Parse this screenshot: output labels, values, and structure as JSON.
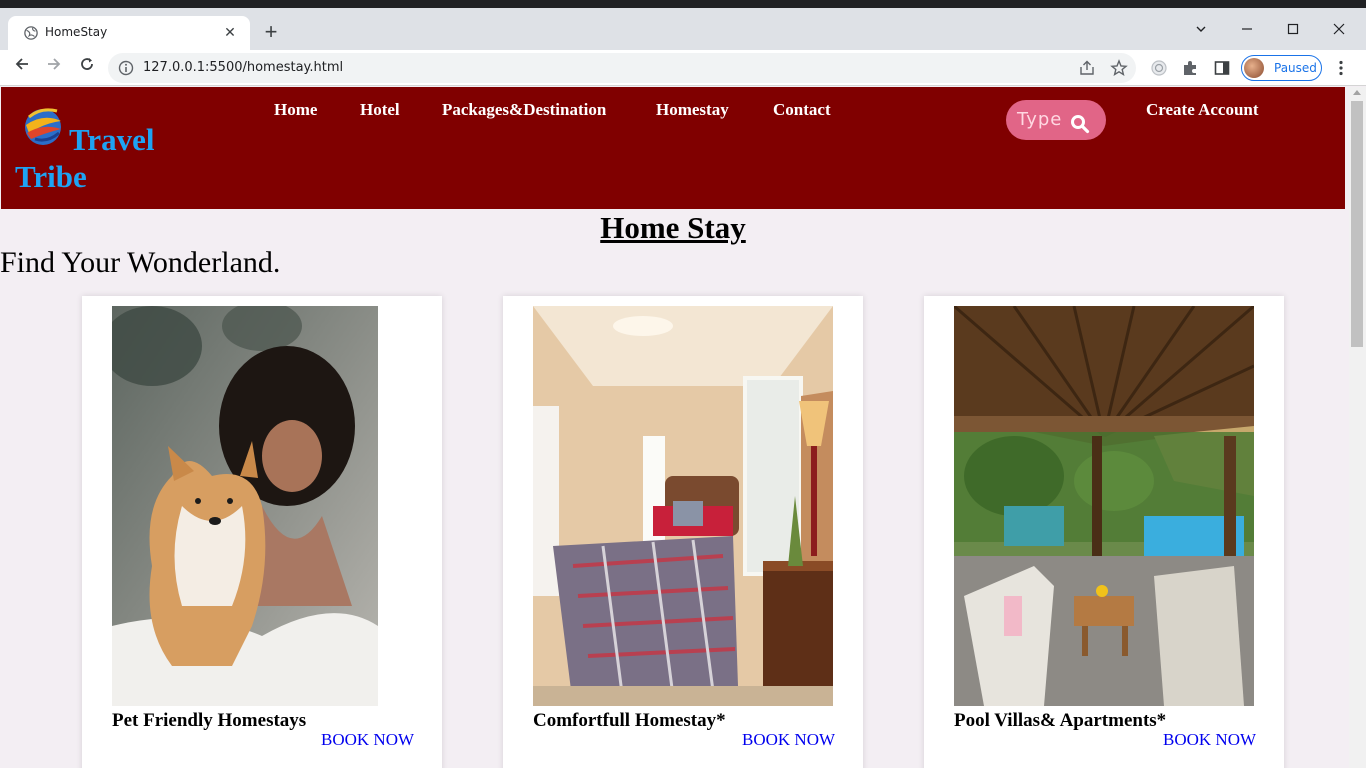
{
  "browser": {
    "tab_title": "HomeStay",
    "url": "127.0.0.1:5500/homestay.html",
    "profile_label": "Paused"
  },
  "site": {
    "logo_line1": "Travel",
    "logo_line2": "Tribe",
    "nav": [
      {
        "label": "Home"
      },
      {
        "label": "Hotel"
      },
      {
        "label": "Packages&Destination"
      },
      {
        "label": "Homestay"
      },
      {
        "label": "Contact"
      }
    ],
    "search_placeholder": "Type",
    "create_account": "Create Account"
  },
  "page": {
    "title": "Home Stay",
    "tagline": "Find Your Wonderland."
  },
  "cards": [
    {
      "caption": "Pet Friendly Homestays",
      "link": "BOOK NOW"
    },
    {
      "caption": "Comfortfull Homestay*",
      "link": "BOOK NOW"
    },
    {
      "caption": "Pool Villas& Apartments*",
      "link": "BOOK NOW"
    }
  ],
  "colors": {
    "header_bg": "#800000",
    "logo_text": "#1ea3f3",
    "search_bg": "#e16587",
    "link": "#0000ee",
    "page_bg": "#f3eef3"
  }
}
